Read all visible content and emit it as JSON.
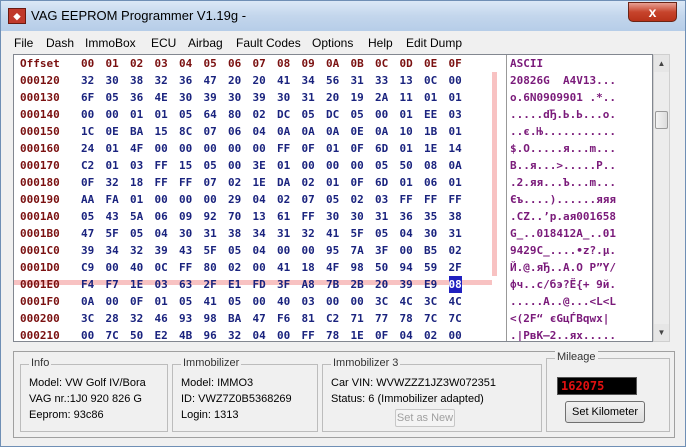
{
  "window": {
    "title": "VAG EEPROM Programmer  V1.19g -",
    "close_label": "x"
  },
  "menu": [
    "File",
    "Dash",
    "ImmoBox",
    "ECU",
    "Airbag",
    "Fault Codes",
    "Options",
    "Help",
    "Edit Dump"
  ],
  "hex": {
    "header_offset": "Offset",
    "header_cols": [
      "00",
      "01",
      "02",
      "03",
      "04",
      "05",
      "06",
      "07",
      "08",
      "09",
      "0A",
      "0B",
      "0C",
      "0D",
      "0E",
      "0F"
    ],
    "header_ascii": "ASCII",
    "rows": [
      {
        "offset": "000120",
        "bytes": [
          "32",
          "30",
          "38",
          "32",
          "36",
          "47",
          "20",
          "20",
          "41",
          "34",
          "56",
          "31",
          "33",
          "13",
          "0C",
          "00"
        ],
        "ascii": "20826G  A4V13..."
      },
      {
        "offset": "000130",
        "bytes": [
          "6F",
          "05",
          "36",
          "4E",
          "30",
          "39",
          "30",
          "39",
          "30",
          "31",
          "20",
          "19",
          "2A",
          "11",
          "01",
          "01"
        ],
        "ascii": "o.6N0909901 .*.."
      },
      {
        "offset": "000140",
        "bytes": [
          "00",
          "00",
          "01",
          "01",
          "05",
          "64",
          "80",
          "02",
          "DC",
          "05",
          "DC",
          "05",
          "00",
          "01",
          "EE",
          "03"
        ],
        "ascii": ".....dЂ.Ь.Ь...o."
      },
      {
        "offset": "000150",
        "bytes": [
          "1C",
          "0E",
          "BA",
          "15",
          "8C",
          "07",
          "06",
          "04",
          "0A",
          "0A",
          "0A",
          "0E",
          "0A",
          "10",
          "1B",
          "01"
        ],
        "ascii": "..є.Њ..........."
      },
      {
        "offset": "000160",
        "bytes": [
          "24",
          "01",
          "4F",
          "00",
          "00",
          "00",
          "00",
          "00",
          "FF",
          "0F",
          "01",
          "0F",
          "6D",
          "01",
          "1E",
          "14"
        ],
        "ascii": "$.O.....я...m..."
      },
      {
        "offset": "000170",
        "bytes": [
          "C2",
          "01",
          "03",
          "FF",
          "15",
          "05",
          "00",
          "3E",
          "01",
          "00",
          "00",
          "00",
          "05",
          "50",
          "08",
          "0A"
        ],
        "ascii": "В..я...>.....P.."
      },
      {
        "offset": "000180",
        "bytes": [
          "0F",
          "32",
          "18",
          "FF",
          "FF",
          "07",
          "02",
          "1E",
          "DA",
          "02",
          "01",
          "0F",
          "6D",
          "01",
          "06",
          "01"
        ],
        "ascii": ".2.яя...Ъ...m..."
      },
      {
        "offset": "000190",
        "bytes": [
          "AA",
          "FA",
          "01",
          "00",
          "00",
          "00",
          "29",
          "04",
          "02",
          "07",
          "05",
          "02",
          "03",
          "FF",
          "FF",
          "FF"
        ],
        "ascii": "Єъ....)......яяя"
      },
      {
        "offset": "0001A0",
        "bytes": [
          "05",
          "43",
          "5A",
          "06",
          "09",
          "92",
          "70",
          "13",
          "61",
          "FF",
          "30",
          "30",
          "31",
          "36",
          "35",
          "38"
        ],
        "ascii": ".CZ..’p.aя001658"
      },
      {
        "offset": "0001B0",
        "bytes": [
          "47",
          "5F",
          "05",
          "04",
          "30",
          "31",
          "38",
          "34",
          "31",
          "32",
          "41",
          "5F",
          "05",
          "04",
          "30",
          "31"
        ],
        "ascii": "G_..018412A_..01"
      },
      {
        "offset": "0001C0",
        "bytes": [
          "39",
          "34",
          "32",
          "39",
          "43",
          "5F",
          "05",
          "04",
          "00",
          "00",
          "95",
          "7A",
          "3F",
          "00",
          "B5",
          "02"
        ],
        "ascii": "9429C_....•z?.µ."
      },
      {
        "offset": "0001D0",
        "bytes": [
          "C9",
          "00",
          "40",
          "0C",
          "FF",
          "80",
          "02",
          "00",
          "41",
          "18",
          "4F",
          "98",
          "50",
          "94",
          "59",
          "2F"
        ],
        "ascii": "Й.@.яЂ..A.O P”Y/"
      },
      {
        "offset": "0001E0",
        "bytes": [
          "F4",
          "F7",
          "1E",
          "03",
          "63",
          "2F",
          "E1",
          "FD",
          "3F",
          "A8",
          "7B",
          "2B",
          "20",
          "39",
          "E9",
          "08"
        ],
        "ascii": "фч..c/бэ?Ё{+ 9й."
      },
      {
        "offset": "0001F0",
        "bytes": [
          "0A",
          "00",
          "0F",
          "01",
          "05",
          "41",
          "05",
          "00",
          "40",
          "03",
          "00",
          "00",
          "3C",
          "4C",
          "3C",
          "4C"
        ],
        "ascii": ".....A..@...<L<L"
      },
      {
        "offset": "000200",
        "bytes": [
          "3C",
          "28",
          "32",
          "46",
          "93",
          "98",
          "BA",
          "47",
          "F6",
          "81",
          "C2",
          "71",
          "77",
          "78",
          "7C",
          "7C"
        ],
        "ascii": "<(2F“ єGцЃВqwx|"
      },
      {
        "offset": "000210",
        "bytes": [
          "00",
          "7C",
          "50",
          "E2",
          "4B",
          "96",
          "32",
          "04",
          "00",
          "FF",
          "78",
          "1E",
          "0F",
          "04",
          "02",
          "00"
        ],
        "ascii": ".|PвK–2..яx....."
      }
    ]
  },
  "info": {
    "title": "Info",
    "model": "Model:  VW Golf IV/Bora",
    "vag_nr": "VAG nr.:1J0 920 826 G",
    "eeprom": "Eeprom: 93c86"
  },
  "immobilizer": {
    "title": "Immobilizer",
    "model": "Model:  IMMO3",
    "id": "ID: VWZ7Z0B5368269",
    "login": "Login: 1313"
  },
  "immobilizer3": {
    "title": "Immobilizer 3",
    "car_vin": "Car VIN:  WVWZZZ1JZ3W072351",
    "status": "Status: 6 (Immobilizer adapted)",
    "set_as_new": "Set as New"
  },
  "mileage": {
    "title": "Mileage",
    "value": "162075",
    "set_km": "Set Kilometer"
  },
  "colors": {
    "offset": "#7a1010",
    "hex": "#1a237e",
    "ascii": "#7a1a7a",
    "selection": "#2020c0",
    "crosshair": "#f07878",
    "mileage_digits": "#e01010"
  }
}
